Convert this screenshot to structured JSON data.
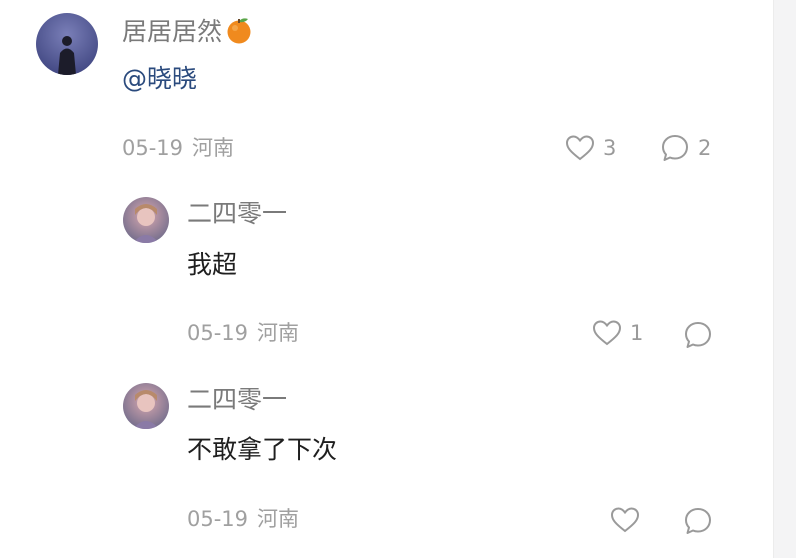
{
  "main_comment": {
    "author": "居居居然",
    "badge_icon": "orange-fruit-icon",
    "mention": "@晓晓",
    "date": "05-19",
    "location": "河南",
    "like_count": "3",
    "reply_count": "2"
  },
  "replies": [
    {
      "author": "二四零一",
      "text": "我超",
      "date": "05-19",
      "location": "河南",
      "like_count": "1",
      "reply_count": ""
    },
    {
      "author": "二四零一",
      "text": "不敢拿了下次",
      "date": "05-19",
      "location": "河南",
      "like_count": "",
      "reply_count": ""
    }
  ],
  "icons": {
    "like": "heart-outline-icon",
    "reply": "speech-bubble-icon"
  },
  "colors": {
    "author": "#7a7a7a",
    "mention": "#2a4a7d",
    "meta": "#a0a0a0",
    "body_text": "#1f1f1f",
    "badge_orange": "#f08a1e"
  }
}
